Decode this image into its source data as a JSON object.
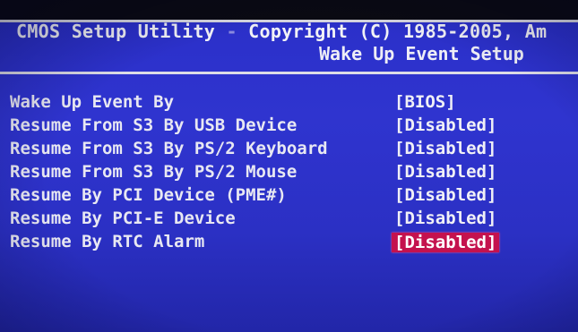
{
  "header": {
    "title_brand": "CMOS Setup Utility",
    "title_separator": " - ",
    "title_copyright": "Copyright (C) 1985-2005, Am",
    "subtitle": "Wake Up Event Setup"
  },
  "settings": [
    {
      "label": "Wake Up Event By",
      "value": "[BIOS]",
      "selected": false
    },
    {
      "label": "Resume From S3 By USB Device",
      "value": "[Disabled]",
      "selected": false
    },
    {
      "label": "Resume From S3 By PS/2 Keyboard",
      "value": "[Disabled]",
      "selected": false
    },
    {
      "label": "Resume From S3 By PS/2 Mouse",
      "value": "[Disabled]",
      "selected": false
    },
    {
      "label": "Resume By PCI Device (PME#)",
      "value": "[Disabled]",
      "selected": false
    },
    {
      "label": "Resume By PCI-E Device",
      "value": "[Disabled]",
      "selected": false
    },
    {
      "label": "Resume By RTC Alarm",
      "value": "[Disabled]",
      "selected": true
    }
  ],
  "colors": {
    "background": "#2f34cf",
    "highlight": "#c4124e",
    "text": "#ececf4"
  }
}
